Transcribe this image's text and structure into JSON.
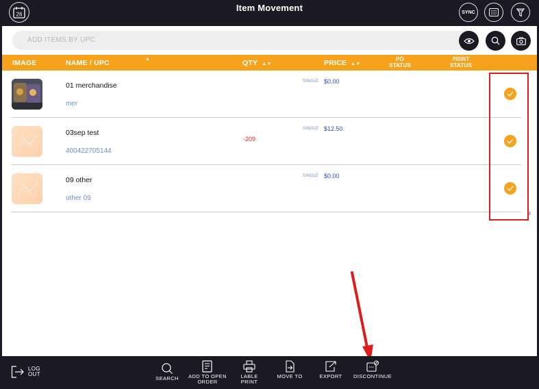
{
  "header": {
    "title": "Item Movement",
    "calendar_day": "26",
    "sync_label": "SYNC"
  },
  "search": {
    "placeholder": "ADD ITEMS BY UPC"
  },
  "table": {
    "columns": {
      "image": "IMAGE",
      "name_upc": "NAME / UPC",
      "qty": "QTY",
      "price": "PRICE",
      "po_status": "PO STATUS",
      "print_status": "PRINT STATUS"
    },
    "rows": [
      {
        "name": "01 merchandise",
        "upc": "mer",
        "qty": "",
        "price_type": "SINGLE",
        "price": "$0.00",
        "image": "photo"
      },
      {
        "name": "03sep test",
        "upc": "400422705144",
        "qty": "-209",
        "price_type": "SINGLE",
        "price": "$12.50",
        "image": "placeholder"
      },
      {
        "name": "09 other",
        "upc": "other 09",
        "qty": "",
        "price_type": "SINGLE",
        "price": "$0.00",
        "image": "placeholder"
      }
    ],
    "footer_mark": "#"
  },
  "toolbar": {
    "logout": "LOG OUT",
    "search": "SEARCH",
    "add_to_open_order": "ADD TO OPEN ORDER",
    "lable_print": "LABLE PRINT",
    "move_to": "MOVE TO",
    "export": "EXPORT",
    "discontinue": "DISCONTINUE"
  },
  "colors": {
    "dark": "#1b1a24",
    "accent": "#f7a21c",
    "highlight": "#e01b1b",
    "link_blue": "#6d8fbf",
    "negative": "#e02424"
  }
}
